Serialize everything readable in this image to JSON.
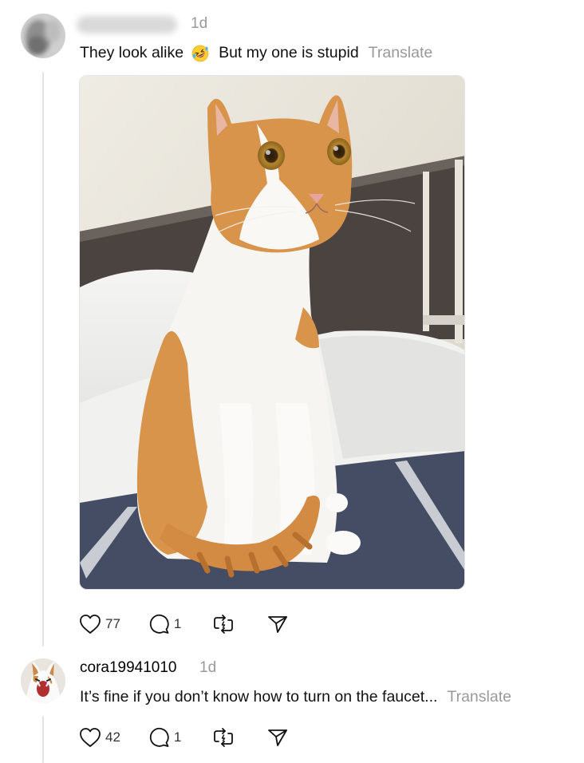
{
  "posts": [
    {
      "author": "",
      "time": "1d",
      "text_before_emoji": "They look alike",
      "emoji": "rolling-on-floor-laughing-emoji",
      "text_after_emoji": "But my one is stupid",
      "translate_label": "Translate",
      "media": "photo of an orange and white cat sitting on a bed",
      "likes": "77",
      "replies": "1"
    },
    {
      "author": "cora19941010",
      "time": "1d",
      "text": "It’s fine if you don’t know how to turn on the faucet...",
      "translate_label": "Translate",
      "likes": "42",
      "replies": "1"
    }
  ],
  "colors": {
    "secondary_text": "#999999",
    "thread_line": "#e3e3e3",
    "cat_orange": "#d9944b"
  }
}
